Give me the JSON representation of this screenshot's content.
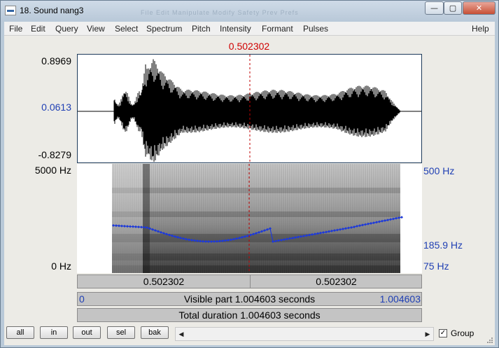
{
  "window": {
    "title": "18. Sound nang3",
    "ghost_menu": "File    Edit    Manipulate    Modify    Safety    Prev    Prefs",
    "minimize_label": "—",
    "maximize_label": "▢",
    "close_label": "✕"
  },
  "menu": {
    "items": [
      "File",
      "Edit",
      "Query",
      "View",
      "Select",
      "Spectrum",
      "Pitch",
      "Intensity",
      "Formant",
      "Pulses"
    ],
    "help": "Help"
  },
  "selection_time": "0.502302",
  "waveform": {
    "ymax": "0.8969",
    "ymid": "0.0613",
    "ymin": "-0.8279"
  },
  "spectrogram": {
    "fmax": "5000 Hz",
    "fmin": "0 Hz",
    "pitch_top": "500 Hz",
    "pitch_mark": "185.9 Hz",
    "pitch_bottom": "75 Hz",
    "pitch_color": "#1e3ad8"
  },
  "bars": {
    "left_time": "0.502302",
    "right_time": "0.502302",
    "visible_start": "0",
    "visible_label": "Visible part 1.004603 seconds",
    "visible_end": "1.004603",
    "total_label": "Total duration 1.004603 seconds"
  },
  "bottom": {
    "buttons": [
      "all",
      "in",
      "out",
      "sel",
      "bak"
    ],
    "scroll_left": "◀",
    "scroll_right": "▶",
    "group_checked": "✓",
    "group_label": "Group"
  }
}
